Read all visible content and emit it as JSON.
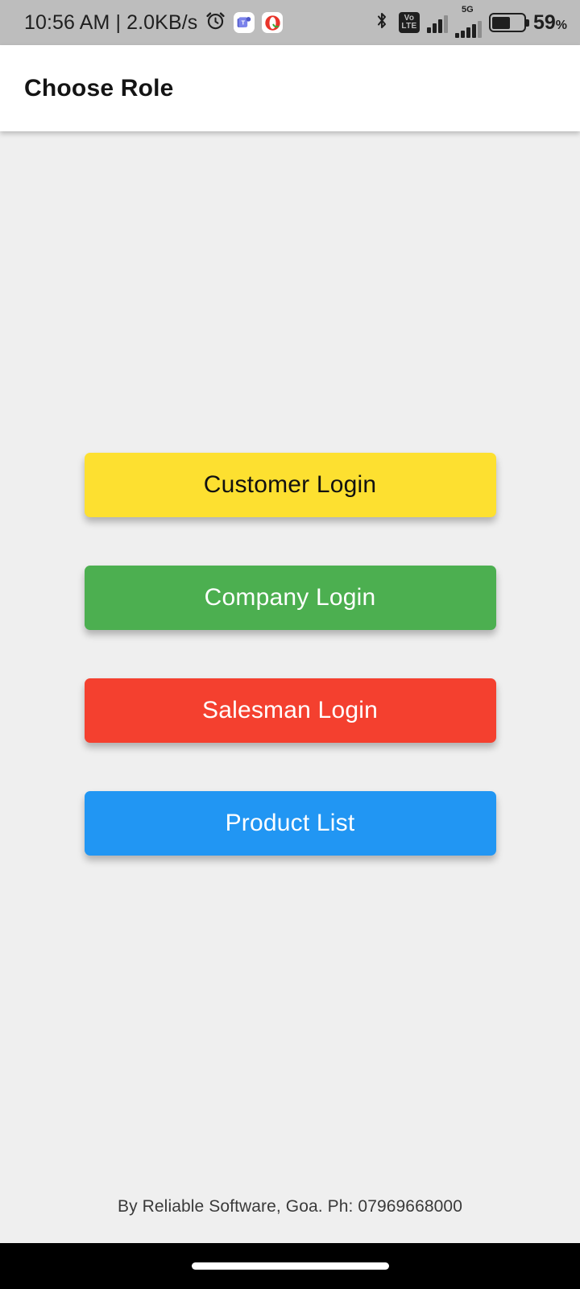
{
  "status_bar": {
    "clock": "10:56 AM | 2.0KB/s",
    "alarm_icon": "alarm-clock-icon",
    "app_icons": [
      {
        "name": "teams-notification-icon"
      },
      {
        "name": "opera-notification-icon"
      }
    ],
    "bluetooth_icon": "bluetooth-icon",
    "volte_top": "Vo",
    "volte_bottom": "LTE",
    "network_label": "5G",
    "battery_percent": "59",
    "battery_percent_suffix": "%",
    "battery_level": 59,
    "background_color": "#BDBDBD"
  },
  "app_bar": {
    "title": "Choose Role",
    "background_color": "#FFFFFF"
  },
  "main": {
    "background_color": "#EFEFEF",
    "buttons": [
      {
        "id": "customer-login",
        "label": "Customer Login",
        "bg": "#FDE030",
        "fg": "#111111"
      },
      {
        "id": "company-login",
        "label": "Company Login",
        "bg": "#4CAF50",
        "fg": "#FFFFFF"
      },
      {
        "id": "salesman-login",
        "label": "Salesman Login",
        "bg": "#F4402F",
        "fg": "#FFFFFF"
      },
      {
        "id": "product-list",
        "label": "Product List",
        "bg": "#2196F3",
        "fg": "#FFFFFF"
      }
    ]
  },
  "footer": {
    "credit": "By Reliable Software, Goa. Ph: 07969668000"
  },
  "nav_bar": {
    "home_indicator": "home-indicator",
    "background_color": "#000000"
  }
}
